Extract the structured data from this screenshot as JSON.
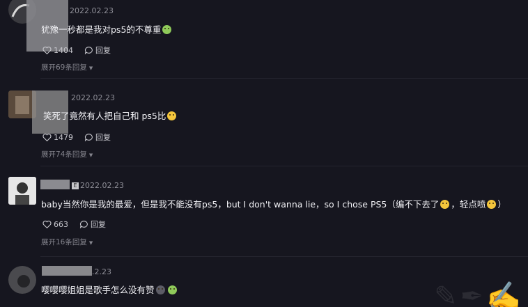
{
  "comments": [
    {
      "date": "2022.02.23",
      "text": "犹豫一秒都是我对ps5的不尊重",
      "likes": "1404",
      "reply_label": "回复",
      "expand_label": "展开69条回复"
    },
    {
      "date": "2022.02.23",
      "text": "笑死了竟然有人把自己和 ps5比",
      "likes": "1479",
      "reply_label": "回复",
      "expand_label": "展开74条回复"
    },
    {
      "date": "2022.02.23",
      "text_a": "baby当然你是我的最爱，但是我不能没有ps5，but I don't wanna lie，so I chose PS5（编不下去了",
      "text_b": "，轻点喷",
      "text_c": "）",
      "likes": "663",
      "reply_label": "回复",
      "expand_label": "展开16条回复"
    },
    {
      "date": ".2.23",
      "text": "嘤嘤嘤姐姐是歌手怎么没有赞"
    }
  ],
  "icons": {
    "like": "heart-icon",
    "reply": "comment-bubble-icon",
    "expand": "caret-down-icon"
  },
  "colors": {
    "background": "#16161f",
    "text": "#f0f0f4",
    "meta": "#8e8e97"
  }
}
